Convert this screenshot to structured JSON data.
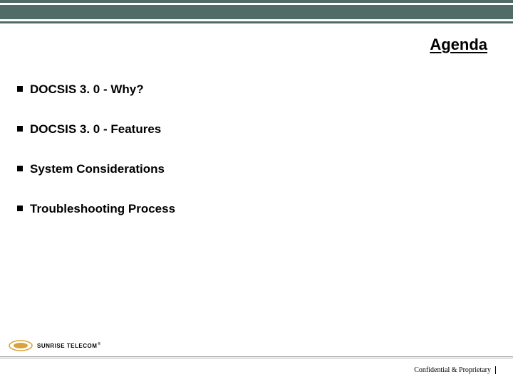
{
  "title": "Agenda",
  "bullets": [
    "DOCSIS 3. 0 - Why?",
    "DOCSIS 3. 0 - Features",
    "System Considerations",
    "Troubleshooting Process"
  ],
  "logo": {
    "brand_text": "SUNRISE TELECOM",
    "registered": "®"
  },
  "footer": "Confidential & Proprietary",
  "colors": {
    "banner": "#516b66",
    "logo_accent": "#d8a33a"
  }
}
